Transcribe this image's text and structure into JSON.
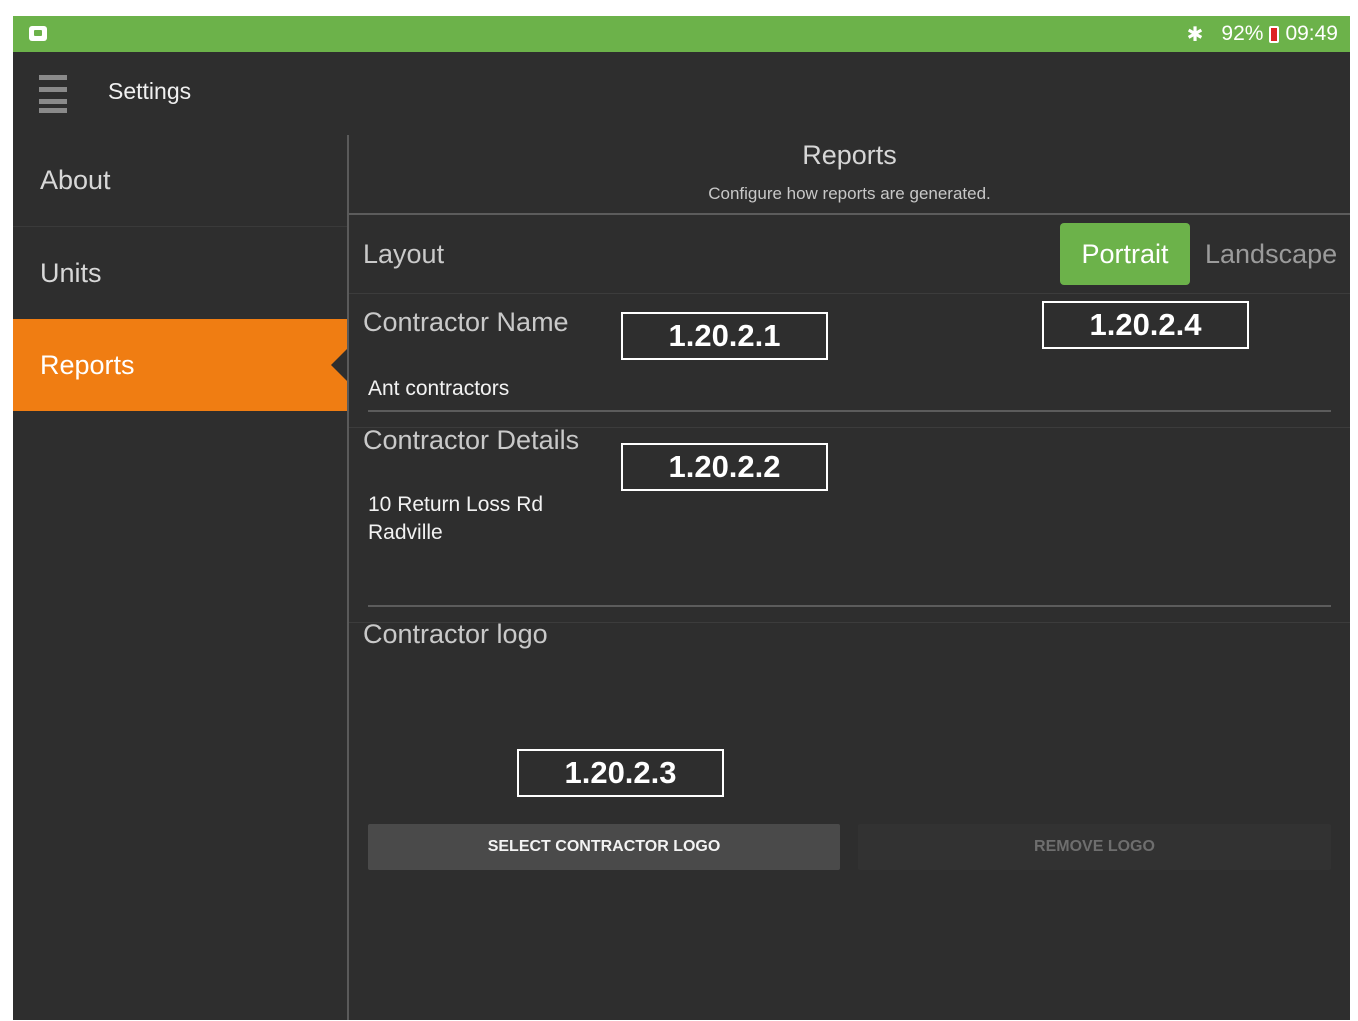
{
  "status_bar": {
    "battery": "92%",
    "time": "09:49"
  },
  "toolbar": {
    "title": "Settings"
  },
  "sidebar": {
    "items": [
      {
        "label": "About"
      },
      {
        "label": "Units"
      },
      {
        "label": "Reports"
      }
    ]
  },
  "content": {
    "header": {
      "title": "Reports",
      "subtitle": "Configure how reports are generated."
    },
    "layout": {
      "label": "Layout",
      "options": [
        "Portrait",
        "Landscape"
      ],
      "selected": "Portrait"
    },
    "contractor_name": {
      "label": "Contractor Name",
      "value": "Ant contractors"
    },
    "contractor_details": {
      "label": "Contractor Details",
      "lines": [
        "10 Return Loss Rd",
        "Radville"
      ]
    },
    "contractor_logo": {
      "label": "Contractor logo",
      "select_button": "SELECT CONTRACTOR LOGO",
      "remove_button": "REMOVE LOGO"
    }
  },
  "callouts": [
    "1.20.2.1",
    "1.20.2.2",
    "1.20.2.3",
    "1.20.2.4"
  ],
  "colors": {
    "status_bar": "#6cb24a",
    "accent_active": "#f07d12",
    "background": "#2e2e2e"
  }
}
